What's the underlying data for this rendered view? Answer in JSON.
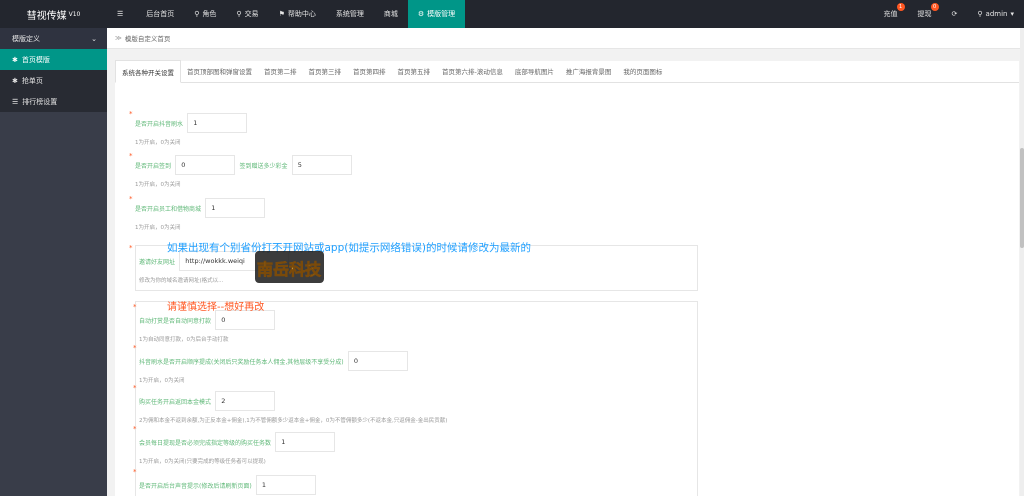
{
  "app": {
    "logo": "彗视传媒",
    "version": "V10"
  },
  "nav": [
    {
      "icon": "☰",
      "label": ""
    },
    {
      "icon": "",
      "label": "后台首页"
    },
    {
      "icon": "⚲",
      "label": "角色"
    },
    {
      "icon": "⚲",
      "label": "交易"
    },
    {
      "icon": "⚑",
      "label": "帮助中心"
    },
    {
      "icon": "",
      "label": "系统管理"
    },
    {
      "icon": "",
      "label": "商城"
    },
    {
      "icon": "⚙",
      "label": "模版管理"
    }
  ],
  "topright": {
    "recharge": {
      "label": "充值",
      "badge": "1"
    },
    "withdraw": {
      "label": "提现",
      "badge": "0"
    },
    "refresh_icon": "⟳",
    "user": {
      "icon": "⚲",
      "label": "admin",
      "caret": "▾"
    }
  },
  "sidebar": {
    "header": "模版定义",
    "header_caret": "⌄",
    "items": [
      {
        "icon": "✱",
        "label": "首页模版"
      },
      {
        "icon": "✱",
        "label": "抢单页"
      },
      {
        "icon": "☰",
        "label": "排行榜设置"
      }
    ]
  },
  "breadcrumb": {
    "arrow": "≫",
    "text": "模版自定义首页"
  },
  "tabs": [
    "系统各种开关设置",
    "首页顶部图和弹窗设置",
    "首页第二排",
    "首页第三排",
    "首页第四排",
    "首页第五排",
    "首页第六排-滚动信息",
    "底部导航图片",
    "推广海报背景图",
    "我的页面图标"
  ],
  "form": {
    "f1": {
      "label": "是否开启抖音刷水",
      "value": "1",
      "help": "1为开启，0为关闭"
    },
    "f2": {
      "label": "是否开启签到",
      "value": "0",
      "label2": "签到赠送多少彩金",
      "value2": "5",
      "help": "1为开启，0为关闭"
    },
    "f3": {
      "label": "是否开启员工和借物商城",
      "value": "1",
      "help": "1为开启，0为关闭"
    },
    "f4": {
      "label": "邀请好友网址",
      "value": "http://wokkk.weiqi",
      "help": "修改为你的域名邀请网址(格式以..."
    },
    "f5": {
      "label": "自动打赏是否自动同意打款",
      "value": "0",
      "help": "1为自动同意打款，0为后台手动打款"
    },
    "f6": {
      "label": "抖音刷水是否开启顺序提成(关闭后只奖励任务本人佣金,其他层级不享受分成)",
      "value": "0",
      "help": "1为开启，0为关闭"
    },
    "f7": {
      "label": "购买任务开启返回本金模式",
      "value": "2",
      "help": "2为佣和本金不返到余额,为正反本金+佣金),1为不管佣额多少返本金+佣金，0为不管佣额多少(不返本金,只返佣金-金出民贡献)"
    },
    "f8": {
      "label": "会员每日提现是否必须完成指定等级的购买任务数",
      "value": "1",
      "help": "1为开启，0为关闭(只要完成的等级任务者可以提现)"
    },
    "f9": {
      "label": "是否开启后台声音提示(修改后请刷新页面)",
      "value": "1"
    }
  },
  "notes": {
    "blue": "如果出现有个别省份打不开网站或app(如提示网络错误)的时候请修改为最新的",
    "red": "请谨慎选择--想好再改"
  },
  "watermark": {
    "text": "南岳科技"
  }
}
